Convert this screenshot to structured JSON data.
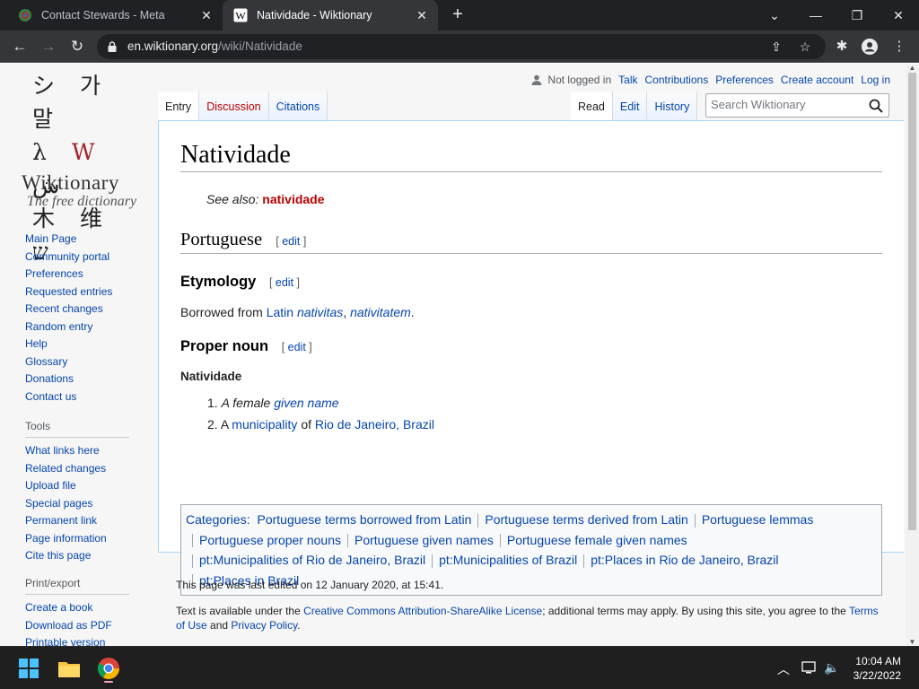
{
  "browser": {
    "tabs": [
      {
        "title": "Contact Stewards - Meta",
        "active": false
      },
      {
        "title": "Natividade - Wiktionary",
        "active": true
      }
    ],
    "url_domain": "en.wiktionary.org",
    "url_path": "/wiki/Natividade",
    "controls": {
      "minimize": "—",
      "maximize": "❐",
      "close": "✕",
      "new_tab": "+",
      "tab_dropdown": "⌄"
    }
  },
  "logo": {
    "glyphs_row1": "シ 가 말",
    "glyphs_row2_a": "λ",
    "glyphs_row2_w": "W",
    "glyphs_row2_b": "ش",
    "glyphs_row3": "木 维 ש",
    "title": "Wiktionary",
    "tagline": "The free dictionary"
  },
  "sidebar": {
    "navigation": [
      "Main Page",
      "Community portal",
      "Preferences",
      "Requested entries",
      "Recent changes",
      "Random entry",
      "Help",
      "Glossary",
      "Donations",
      "Contact us"
    ],
    "tools_heading": "Tools",
    "tools": [
      "What links here",
      "Related changes",
      "Upload file",
      "Special pages",
      "Permanent link",
      "Page information",
      "Cite this page"
    ],
    "print_heading": "Print/export",
    "print": [
      "Create a book",
      "Download as PDF",
      "Printable version"
    ]
  },
  "personal": {
    "not_logged_in": "Not logged in",
    "talk": "Talk",
    "contributions": "Contributions",
    "preferences": "Preferences",
    "create_account": "Create account",
    "log_in": "Log in"
  },
  "tabs_left": {
    "entry": "Entry",
    "discussion": "Discussion",
    "citations": "Citations"
  },
  "tabs_right": {
    "read": "Read",
    "edit": "Edit",
    "history": "History"
  },
  "search": {
    "placeholder": "Search Wiktionary"
  },
  "article": {
    "title": "Natividade",
    "see_also_label": "See also:",
    "see_also_link": "natividade",
    "lang_heading": "Portuguese",
    "edit_label": "edit",
    "etymology_heading": "Etymology",
    "etym_prefix": "Borrowed from",
    "etym_lang": "Latin",
    "etym_word1": "nativitas",
    "etym_comma": ",",
    "etym_word2": "nativitatem",
    "etym_end": ".",
    "pos_heading": "Proper noun",
    "headword": "Natividade",
    "def1_num": "1.",
    "def1_a": "A female",
    "def1_link": "given name",
    "def2_num": "2.",
    "def2_a": "A",
    "def2_link1": "municipality",
    "def2_of": "of",
    "def2_link2": "Rio de Janeiro, Brazil"
  },
  "categories": {
    "label": "Categories:",
    "items": [
      "Portuguese terms borrowed from Latin",
      "Portuguese terms derived from Latin",
      "Portuguese lemmas",
      "Portuguese proper nouns",
      "Portuguese given names",
      "Portuguese female given names",
      "pt:Municipalities of Rio de Janeiro, Brazil",
      "pt:Municipalities of Brazil",
      "pt:Places in Rio de Janeiro, Brazil",
      "pt:Places in Brazil"
    ]
  },
  "footer": {
    "last_edited": "This page was last edited on 12 January 2020, at 15:41.",
    "license_prefix": "Text is available under the",
    "license_link": "Creative Commons Attribution-ShareAlike License",
    "license_mid": "; additional terms may apply. By using this site, you agree to the",
    "terms_link": "Terms of Use",
    "and": "and",
    "privacy_link": "Privacy Policy",
    "end": "."
  },
  "taskbar": {
    "time": "10:04 AM",
    "date": "3/22/2022"
  },
  "colors": {
    "link": "#0645ad",
    "redlink": "#ba0000",
    "chrome_dark": "#202124"
  }
}
